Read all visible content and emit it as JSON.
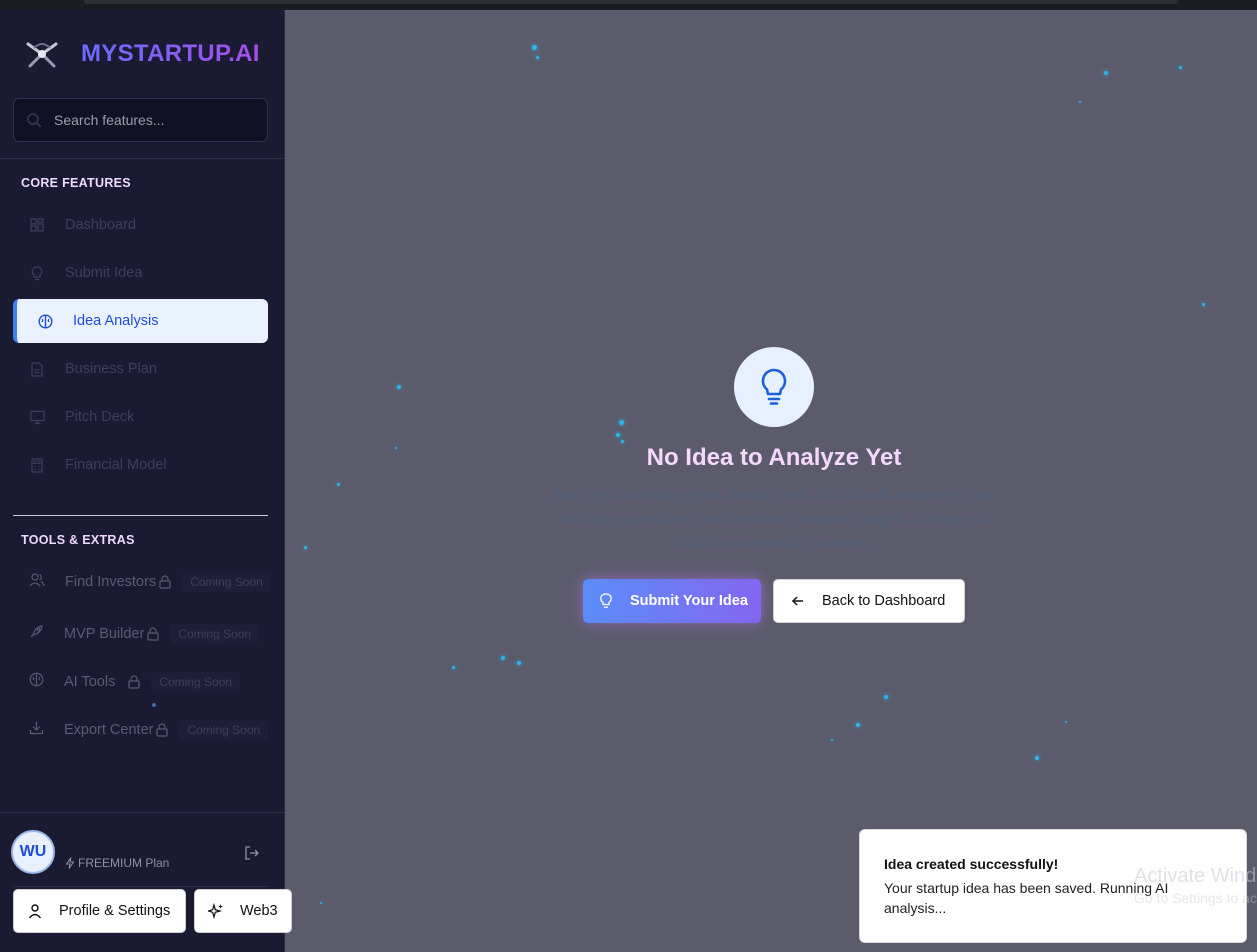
{
  "brand": {
    "name": "MYSTARTUP.AI"
  },
  "search": {
    "placeholder": "Search features..."
  },
  "sections": {
    "core": "CORE FEATURES",
    "tools": "TOOLS & EXTRAS"
  },
  "core_items": [
    {
      "label": "Dashboard",
      "icon": "dashboard-icon"
    },
    {
      "label": "Submit Idea",
      "icon": "lightbulb-icon"
    },
    {
      "label": "Idea Analysis",
      "icon": "brain-icon",
      "active": true
    },
    {
      "label": "Business Plan",
      "icon": "document-icon"
    },
    {
      "label": "Pitch Deck",
      "icon": "presentation-icon"
    },
    {
      "label": "Financial Model",
      "icon": "calculator-icon"
    }
  ],
  "tool_items": [
    {
      "label": "Find Investors",
      "badge": "Coming Soon",
      "icon": "users-icon"
    },
    {
      "label": "MVP Builder",
      "badge": "Coming Soon",
      "icon": "rocket-icon"
    },
    {
      "label": "AI Tools",
      "badge": "Coming Soon",
      "icon": "brain-icon"
    },
    {
      "label": "Export Center",
      "badge": "Coming Soon",
      "icon": "download-icon"
    }
  ],
  "user": {
    "initials": "WU",
    "plan": "FREEMIUM Plan"
  },
  "footer_buttons": {
    "profile": "Profile & Settings",
    "web3": "Web3"
  },
  "empty_state": {
    "title": "No Idea to Analyze Yet",
    "description": "Start by submitting your startup idea. Our AI will analyze it, ask clarifying questions, and provide valuable insights to help you build a successful business.",
    "primary_button": "Submit Your Idea",
    "secondary_button": "Back to Dashboard"
  },
  "toast": {
    "title": "Idea created successfully!",
    "body": "Your startup idea has been saved. Running AI analysis..."
  },
  "watermark": {
    "line1": "Activate Windows",
    "line2": "Go to Settings to activate Windows."
  },
  "colors": {
    "sidebar_bg": "#1a1a33",
    "main_bg": "#5b5b6b",
    "accent": "#3b82f6",
    "brand_gradient_start": "#6a6cff",
    "brand_gradient_end": "#a34fe8"
  }
}
